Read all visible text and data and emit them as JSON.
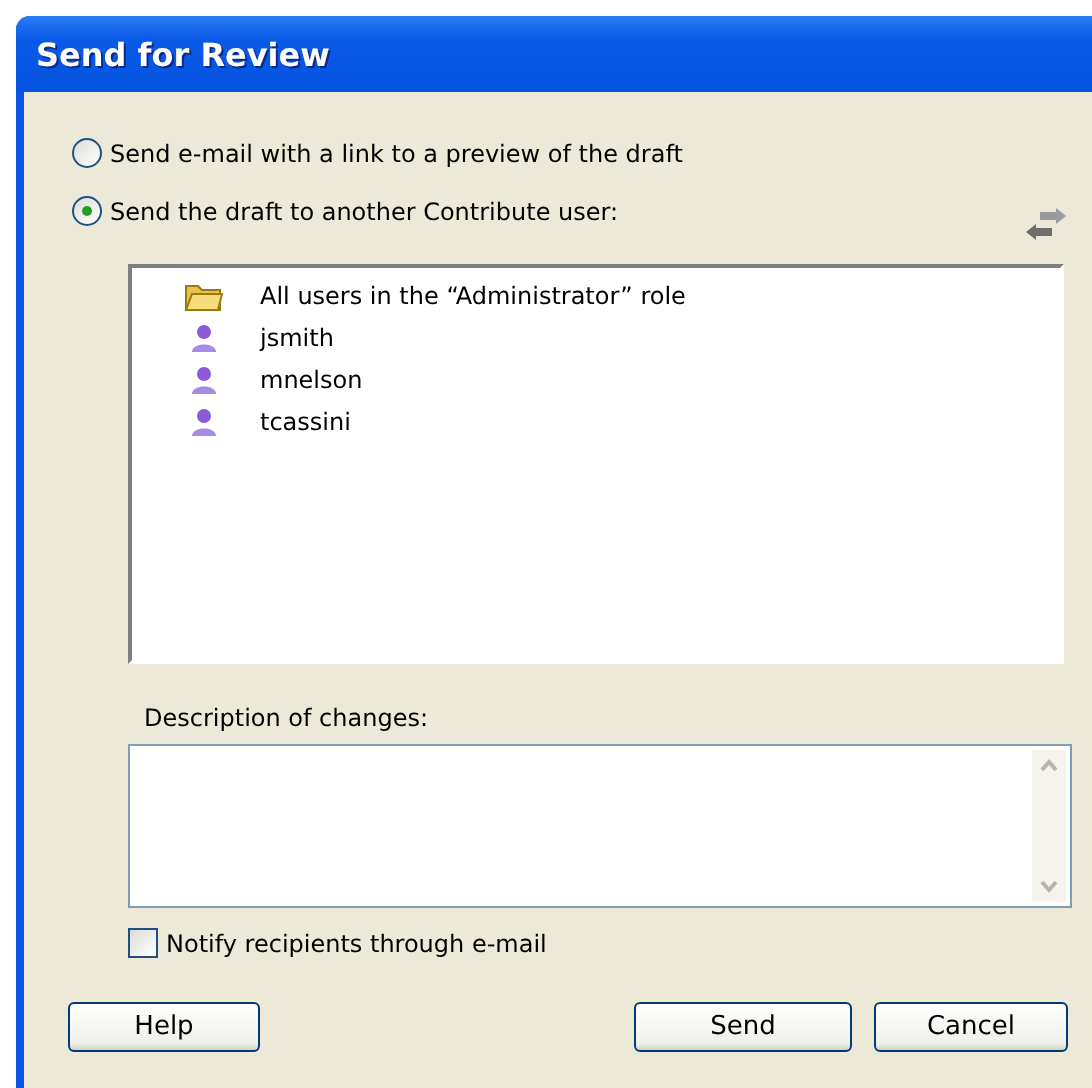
{
  "window": {
    "title": "Send for Review"
  },
  "options": [
    {
      "label": "Send e-mail with a link to a preview of the draft",
      "selected": false
    },
    {
      "label": "Send the draft to another Contribute user:",
      "selected": true
    }
  ],
  "recipients": [
    {
      "kind": "folder",
      "label": "All users in the “Administrator” role"
    },
    {
      "kind": "user",
      "label": "jsmith"
    },
    {
      "kind": "user",
      "label": "mnelson"
    },
    {
      "kind": "user",
      "label": "tcassini"
    }
  ],
  "description": {
    "label": "Description of changes:"
  },
  "notify": {
    "label": "Notify recipients through e-mail",
    "checked": false
  },
  "buttons": [
    "Help",
    "Send",
    "Cancel"
  ]
}
